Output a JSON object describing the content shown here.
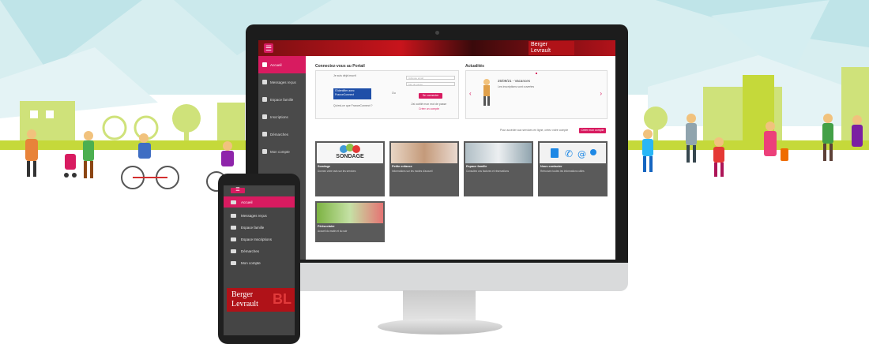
{
  "window": {
    "brand_line1": "Berger",
    "brand_line2": "Levrault"
  },
  "sidebar": {
    "items": [
      {
        "label": "Accueil",
        "icon": "home-icon",
        "active": true
      },
      {
        "label": "Messages reçus",
        "icon": "user-icon"
      },
      {
        "label": "Espace famille",
        "icon": "family-icon"
      },
      {
        "label": "Inscriptions",
        "icon": "register-icon"
      },
      {
        "label": "Démarches",
        "icon": "steps-icon"
      },
      {
        "label": "Mon compte",
        "icon": "account-icon"
      }
    ]
  },
  "login": {
    "title": "Connectez-vous au Portail",
    "intro": "Je suis déjà inscrit",
    "franceconnect_label": "S'identifier avec FranceConnect",
    "franceconnect_link": "Qu'est-ce que FranceConnect ?",
    "or": "Ou",
    "email_placeholder": "Adresse email",
    "password_placeholder": "Mot de passe",
    "submit": "Se connecter",
    "forgot": "J'ai oublié mon mot de passe",
    "create": "Créer un compte"
  },
  "news": {
    "title": "Actualités",
    "date": "25/09/21 - Vacances",
    "text": "Les inscriptions sont ouvertes"
  },
  "bar": {
    "text": "Pour accéder aux services en ligne, créez votre compte",
    "button": "Créer mon compte"
  },
  "tiles": [
    {
      "title": "Sondage",
      "img_text": "SONDAGE",
      "desc": "Donnez votre avis sur les services"
    },
    {
      "title": "Petite enfance",
      "desc": "Informations sur les modes d'accueil"
    },
    {
      "title": "Espace famille",
      "desc": "Consultez vos factures et réservations"
    },
    {
      "title": "Nous contacter",
      "desc": "Retrouvez toutes les informations utiles"
    },
    {
      "title": "Périscolaire",
      "desc": "Accueil du matin et du soir"
    }
  ],
  "phone": {
    "menu": "☰",
    "items": [
      {
        "label": "Accueil",
        "icon": "home-icon",
        "active": true
      },
      {
        "label": "Messages reçus",
        "icon": "messages-icon"
      },
      {
        "label": "Espace famille",
        "icon": "family-icon"
      },
      {
        "label": "Espace Inscriptions",
        "icon": "register-icon"
      },
      {
        "label": "Démarches",
        "icon": "steps-icon"
      },
      {
        "label": "Mon compte",
        "icon": "account-icon"
      }
    ],
    "logo_line1": "Berger",
    "logo_line2": "Levrault",
    "logo_mark": "BL"
  },
  "colors": {
    "accent": "#d81b60",
    "brand_red": "#b01218",
    "sky": "#bfe4e8",
    "ground": "#c5d93a"
  }
}
